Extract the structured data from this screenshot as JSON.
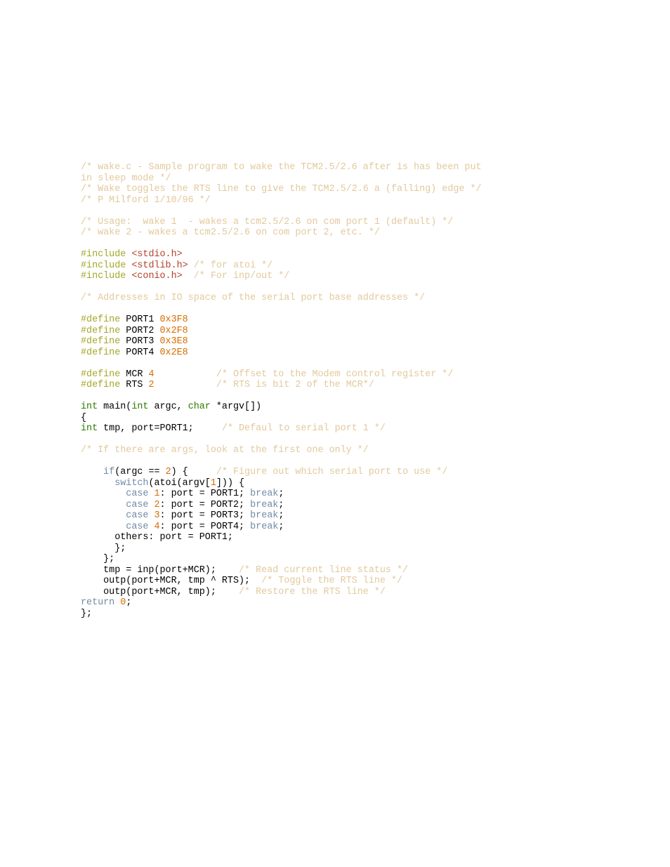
{
  "code": {
    "c01": "/* wake.c - Sample program to wake the TCM2.5/2.6 after is has been put ",
    "c02": "in sleep mode */",
    "c03": "/* Wake toggles the RTS line to give the TCM2.5/2.6 a (falling) edge */",
    "c04": "/* P Milford 1/10/96 */",
    "c05": "/* Usage:  wake 1  - wakes a tcm2.5/2.6 on com port 1 (default) */",
    "c06": "/* wake 2 - wakes a tcm2.5/2.6 on com port 2, etc. */",
    "pp_include": "#include",
    "hdr_stdio": " <stdio.h>",
    "hdr_stdlib": " <stdlib.h>",
    "c_stdlib": " /* for atoi */",
    "hdr_conio": " <conio.h>",
    "c_conio": "  /* For inp/out */",
    "c07": "/* Addresses in IO space of the serial port base addresses */",
    "pp_define": "#define",
    "d_port1": " PORT1 ",
    "v_port1": "0x3F8",
    "d_port2": " PORT2 ",
    "v_port2": "0x2F8",
    "d_port3": " PORT3 ",
    "v_port3": "0x3E8",
    "d_port4": " PORT4 ",
    "v_port4": "0x2E8",
    "d_mcr": " MCR ",
    "v_mcr": "4           ",
    "c_mcr": "/* Offset to the Modem control register */",
    "d_rts": " RTS ",
    "v_rts": "2           ",
    "c_rts": "/* RTS is bit 2 of the MCR*/",
    "t_int": "int",
    "t_char": "char",
    "main_sig_1": " main(",
    "main_sig_2": " argc, ",
    "main_sig_3": " *argv[])",
    "brace_open": "{",
    "decl_1": " tmp, port=PORT1;     ",
    "c_decl": "/* Defaul to serial port 1 */",
    "c08": "/* If there are args, look at the first one only */",
    "kw_if": "if",
    "if_cond_1": "(argc == ",
    "n_2": "2",
    "if_cond_2": ") {     ",
    "c_if": "/* Figure out which serial port to use */",
    "kw_switch": "switch",
    "sw_open": "(atoi(argv[",
    "n_1": "1",
    "sw_close": "])) {",
    "kw_case": "case",
    "kw_break": "break",
    "case1_mid": ": port = PORT1; ",
    "case1_n": "1",
    "case2_mid": ": port = PORT2; ",
    "case2_n": "2",
    "case3_mid": ": port = PORT3; ",
    "case3_n": "3",
    "case4_mid": ": port = PORT4; ",
    "case4_n": "4",
    "semi": ";",
    "others": "      others: port = PORT1;",
    "sw_end": "      };",
    "if_end": "    };",
    "stmt_inp": "    tmp = inp(port+MCR);    ",
    "c_inp": "/* Read current line status */",
    "stmt_out1": "    outp(port+MCR, tmp ^ RTS);  ",
    "c_out1": "/* Toggle the RTS line */",
    "stmt_out2": "    outp(port+MCR, tmp);    ",
    "c_out2": "/* Restore the RTS line */",
    "kw_return": "return",
    "ret_val": "0",
    "brace_close": "};",
    "sp_case": "        ",
    "sp4": "    ",
    "sp6": "      ",
    "sp1": " "
  }
}
